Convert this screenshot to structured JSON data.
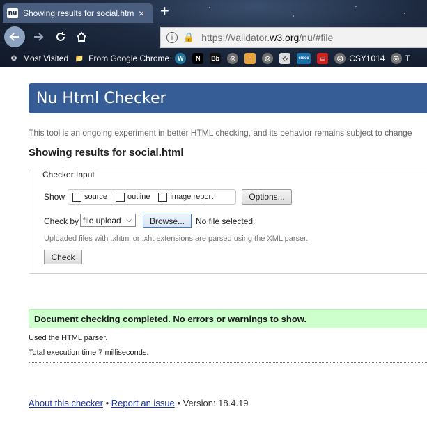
{
  "browser": {
    "tab_favicon": "nu",
    "tab_title": "Showing results for social.html",
    "tab_close": "×",
    "new_tab": "+",
    "url_prefix": "https://validator.",
    "url_domain": "w3.org",
    "url_path": "/nu/#file",
    "bookmarks": [
      {
        "label": "Most Visited",
        "icon": "gear-icon"
      },
      {
        "label": "From Google Chrome",
        "icon": "folder-icon"
      }
    ],
    "bookmark_icons": [
      {
        "name": "wordpress-icon",
        "glyph": "W",
        "bg": "#21759b"
      },
      {
        "name": "uon-icon",
        "glyph": "N",
        "bg": "#000000"
      },
      {
        "name": "blackboard-icon",
        "glyph": "Bb",
        "bg": "#111111"
      },
      {
        "name": "globe-icon",
        "glyph": "◎",
        "bg": "#6f6f6f"
      },
      {
        "name": "rainbow-icon",
        "glyph": "∩",
        "bg": "#e8a23a"
      },
      {
        "name": "globe-icon-2",
        "glyph": "◎",
        "bg": "#6f6f6f"
      },
      {
        "name": "diamond-icon",
        "glyph": "◇",
        "bg": "#dddddd"
      },
      {
        "name": "cisco-icon",
        "glyph": "cisco",
        "bg": "#1b6fa8"
      },
      {
        "name": "oracle-icon",
        "glyph": "▭",
        "bg": "#d21f1f"
      }
    ],
    "bookmark_last": {
      "label": "CSY1014",
      "icon": "globe-icon"
    },
    "bookmark_cut": "T"
  },
  "page": {
    "banner_title": "Nu Html Checker",
    "tagline": "This tool is an ongoing experiment in better HTML checking, and its behavior remains subject to change",
    "results_title": "Showing results for social.html",
    "checker_legend": "Checker Input",
    "show_label": "Show",
    "show_options": [
      "source",
      "outline",
      "image report"
    ],
    "options_button": "Options...",
    "checkby_label": "Check by",
    "checkby_value": "file upload",
    "browse_button": "Browse...",
    "file_status": "No file selected.",
    "xml_note": "Uploaded files with .xhtml or .xht extensions are parsed using the XML parser.",
    "check_button": "Check",
    "success_message": "Document checking completed. No errors or warnings to show.",
    "parser_note": "Used the HTML parser.",
    "exec_note": "Total execution time 7 milliseconds.",
    "footer": {
      "about": "About this checker",
      "sep1": " • ",
      "report": "Report an issue",
      "version": " • Version: 18.4.19"
    }
  },
  "colors": {
    "banner": "#365d95",
    "success_bg": "#ccffcc",
    "link": "#1a34a8"
  }
}
